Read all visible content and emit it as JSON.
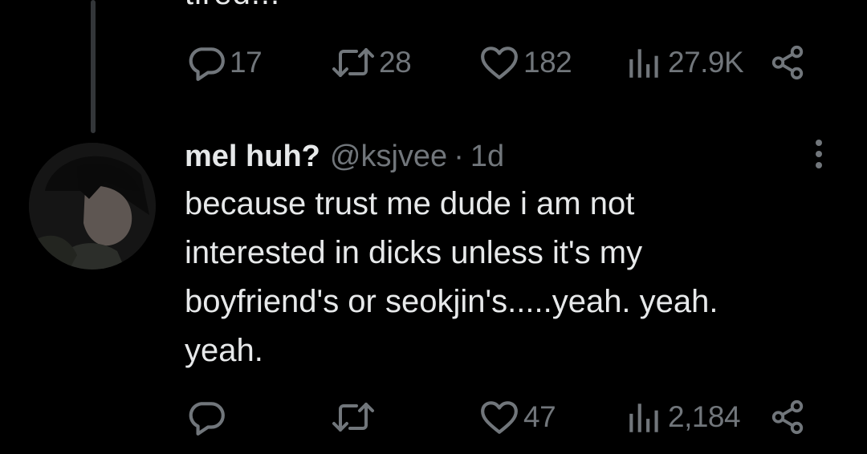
{
  "previous_tweet": {
    "text_tail": "tired...",
    "actions": {
      "reply_icon": "reply-icon",
      "reply_count": "17",
      "retweet_icon": "retweet-icon",
      "retweet_count": "28",
      "like_icon": "heart-icon",
      "like_count": "182",
      "views_icon": "views-icon",
      "views_count": "27.9K",
      "share_icon": "share-icon"
    }
  },
  "reply_tweet": {
    "display_name": "mel huh?",
    "handle": "@ksjvee",
    "separator": "·",
    "time": "1d",
    "text_lines": [
      "because trust me dude i am not",
      "interested in dicks unless it's my",
      "boyfriend's or seokjin's.....yeah. yeah.",
      "yeah."
    ],
    "actions": {
      "reply_count": "",
      "retweet_count": "",
      "like_count": "47",
      "views_count": "2,184"
    }
  },
  "colors": {
    "background": "#000000",
    "text_primary": "#e7e9ea",
    "text_secondary": "#71767b",
    "thread_line": "#333639"
  }
}
